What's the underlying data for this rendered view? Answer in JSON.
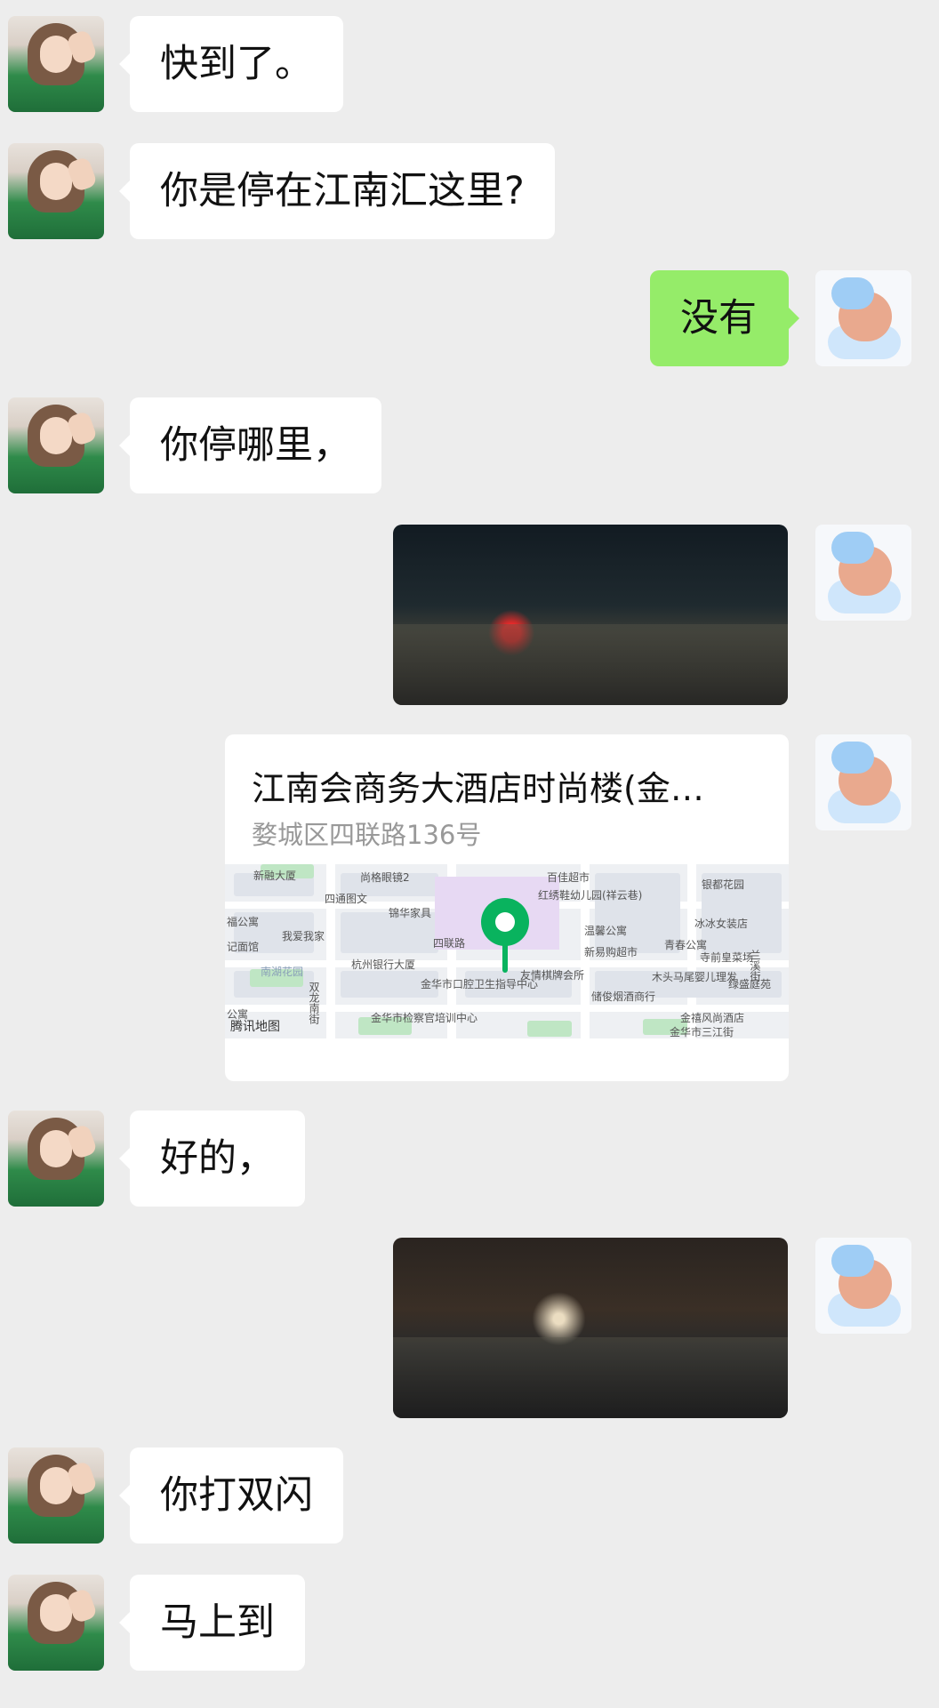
{
  "messages": [
    {
      "side": "in",
      "type": "text",
      "text": "快到了。"
    },
    {
      "side": "in",
      "type": "text",
      "text": "你是停在江南汇这里?"
    },
    {
      "side": "out",
      "type": "text",
      "text": "没有"
    },
    {
      "side": "in",
      "type": "text",
      "text": "你停哪里，"
    },
    {
      "side": "out",
      "type": "image"
    },
    {
      "side": "out",
      "type": "location",
      "title": "江南会商务大酒店时尚楼(金…",
      "address": "婺城区四联路136号",
      "map_brand": "腾讯地图",
      "map_labels": [
        "新融大厦",
        "尚格眼镜2",
        "四通图文",
        "锦华家具",
        "福公寓",
        "我爱我家",
        "记面馆",
        "南湖花园",
        "杭州银行大厦",
        "金华市口腔卫生指导中心",
        "金华市检察官培训中心",
        "四联路",
        "百佳超市",
        "红绣鞋幼儿园(祥云巷)",
        "银都花园",
        "温馨公寓",
        "冰冰女装店",
        "新易购超市",
        "青春公寓",
        "寺前皇菜场",
        "友情棋牌会所",
        "木头马尾婴儿理发",
        "储俊烟酒商行",
        "金禧风尚酒店",
        "金华市三江街",
        "绿盛庭苑",
        "双龙南街",
        "公寓",
        "兰溪街"
      ]
    },
    {
      "side": "in",
      "type": "text",
      "text": "好的，"
    },
    {
      "side": "out",
      "type": "image"
    },
    {
      "side": "in",
      "type": "text",
      "text": "你打双闪"
    },
    {
      "side": "in",
      "type": "text",
      "text": "马上到"
    }
  ]
}
